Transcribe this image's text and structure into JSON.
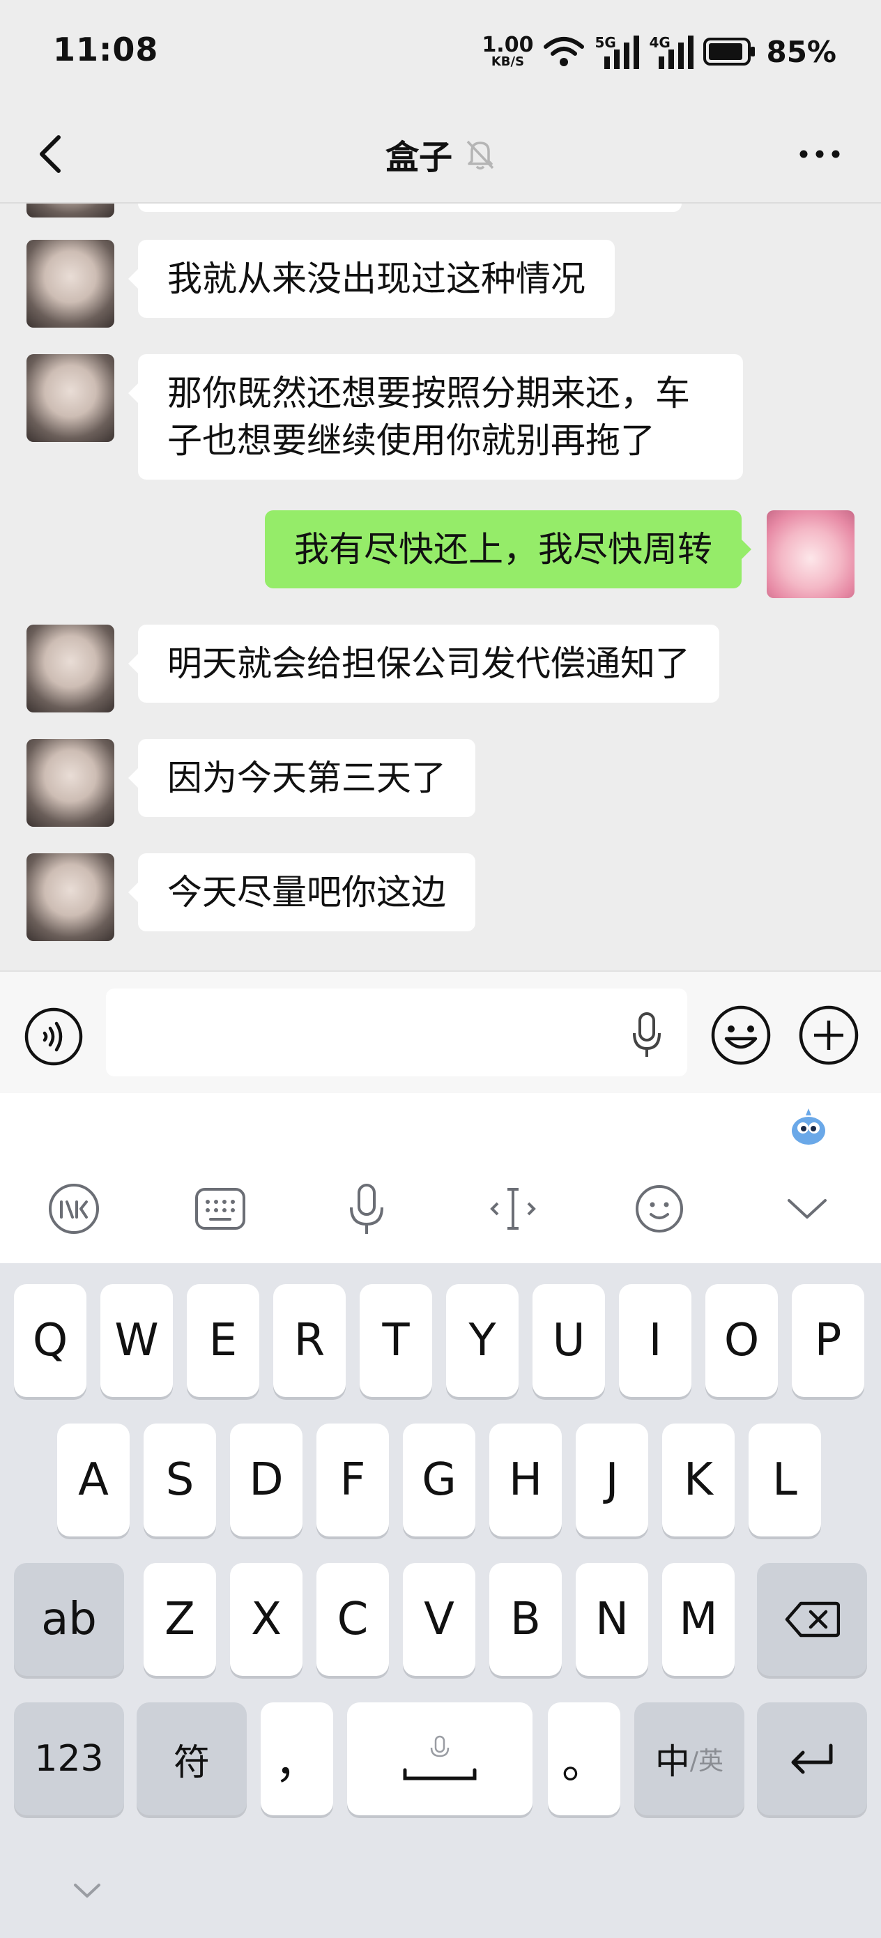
{
  "status": {
    "time": "11:08",
    "net_speed_value": "1.00",
    "net_speed_unit": "KB/S",
    "signal_5g": "5G",
    "signal_4g": "4G",
    "battery": "85%"
  },
  "header": {
    "title": "盒子",
    "muted_icon": "bell-off-icon"
  },
  "messages": [
    {
      "side": "left",
      "text": "我就从来没出现过这种情况"
    },
    {
      "side": "left",
      "text": "那你既然还想要按照分期来还，车子也想要继续使用你就别再拖了"
    },
    {
      "side": "right",
      "text": "我有尽快还上，我尽快周转"
    },
    {
      "side": "left",
      "text": "明天就会给担保公司发代偿通知了"
    },
    {
      "side": "left",
      "text": "因为今天第三天了"
    },
    {
      "side": "left",
      "text": "今天尽量吧你这边"
    }
  ],
  "input": {
    "value": "",
    "placeholder": ""
  },
  "keyboard": {
    "row1": [
      "Q",
      "W",
      "E",
      "R",
      "T",
      "Y",
      "U",
      "I",
      "O",
      "P"
    ],
    "row2": [
      "A",
      "S",
      "D",
      "F",
      "G",
      "H",
      "J",
      "K",
      "L"
    ],
    "row3": [
      "Z",
      "X",
      "C",
      "V",
      "B",
      "N",
      "M"
    ],
    "ab": "ab",
    "num": "123",
    "symbol": "符",
    "comma": "，",
    "period": "。",
    "lang_main": "中",
    "lang_sub": "/英"
  },
  "colors": {
    "my_bubble": "#95ec69",
    "their_bubble": "#ffffff",
    "background": "#ededed"
  }
}
